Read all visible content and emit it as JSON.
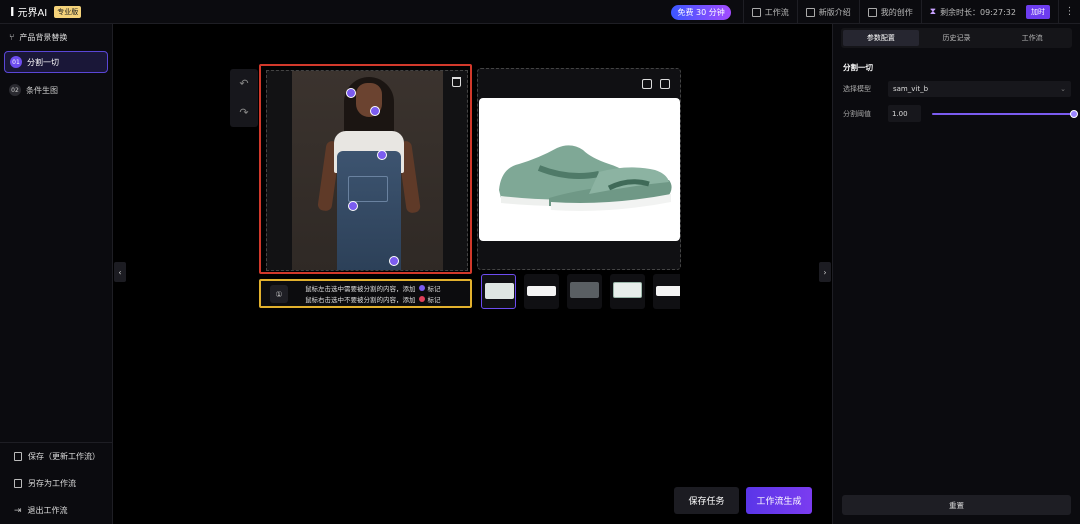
{
  "header": {
    "logo_mark": "I",
    "logo_text": "元界AI",
    "pro_badge": "专业版",
    "free_pill": "免费 30 分钟",
    "links": [
      {
        "label": "工作流",
        "icon": "workflow-icon"
      },
      {
        "label": "新版介绍",
        "icon": "intro-icon"
      },
      {
        "label": "我的创作",
        "icon": "gallery-icon"
      }
    ],
    "remaining_label": "剩余时长：09:27:32",
    "recharge_label": "加时",
    "more_icon": "⋮"
  },
  "sidebar": {
    "title": "产品背景替换",
    "steps": [
      {
        "num": "01",
        "label": "分割一切",
        "active": true
      },
      {
        "num": "02",
        "label": "条件生图",
        "active": false
      }
    ],
    "actions": [
      {
        "label": "保存（更新工作流）",
        "icon": "save-icon"
      },
      {
        "label": "另存为工作流",
        "icon": "save-as-icon"
      },
      {
        "label": "退出工作流",
        "icon": "exit-icon"
      }
    ]
  },
  "canvas": {
    "undo_icon": "↶",
    "redo_icon": "↷",
    "markers": 5,
    "hint_icon": "①",
    "hint_line1": "鼠标左击选中需要被分割的内容，添加",
    "hint_mark_positive": "标记",
    "hint_line2": "鼠标右击选中不要被分割的内容，添加",
    "hint_mark_negative": "标记",
    "positive_color": "#7b5cf0",
    "negative_color": "#e0405a",
    "collapse_left": "‹",
    "collapse_right": "›"
  },
  "actions": {
    "save_task": "保存任务",
    "generate": "工作流生成"
  },
  "right_panel": {
    "tabs": [
      "参数配置",
      "历史记录",
      "工作流"
    ],
    "active_tab": 0,
    "section_title": "分割一切",
    "model_label": "选择模型",
    "model_value": "sam_vit_b",
    "threshold_label": "分割阈值",
    "threshold_value": "1.00",
    "threshold_fraction": 1.0,
    "reset_label": "重置"
  },
  "colors": {
    "accent": "#6d4df0",
    "marker": "#7b5cf0",
    "left_canvas_border": "#d2392b",
    "hint_border": "#e2b12d"
  }
}
